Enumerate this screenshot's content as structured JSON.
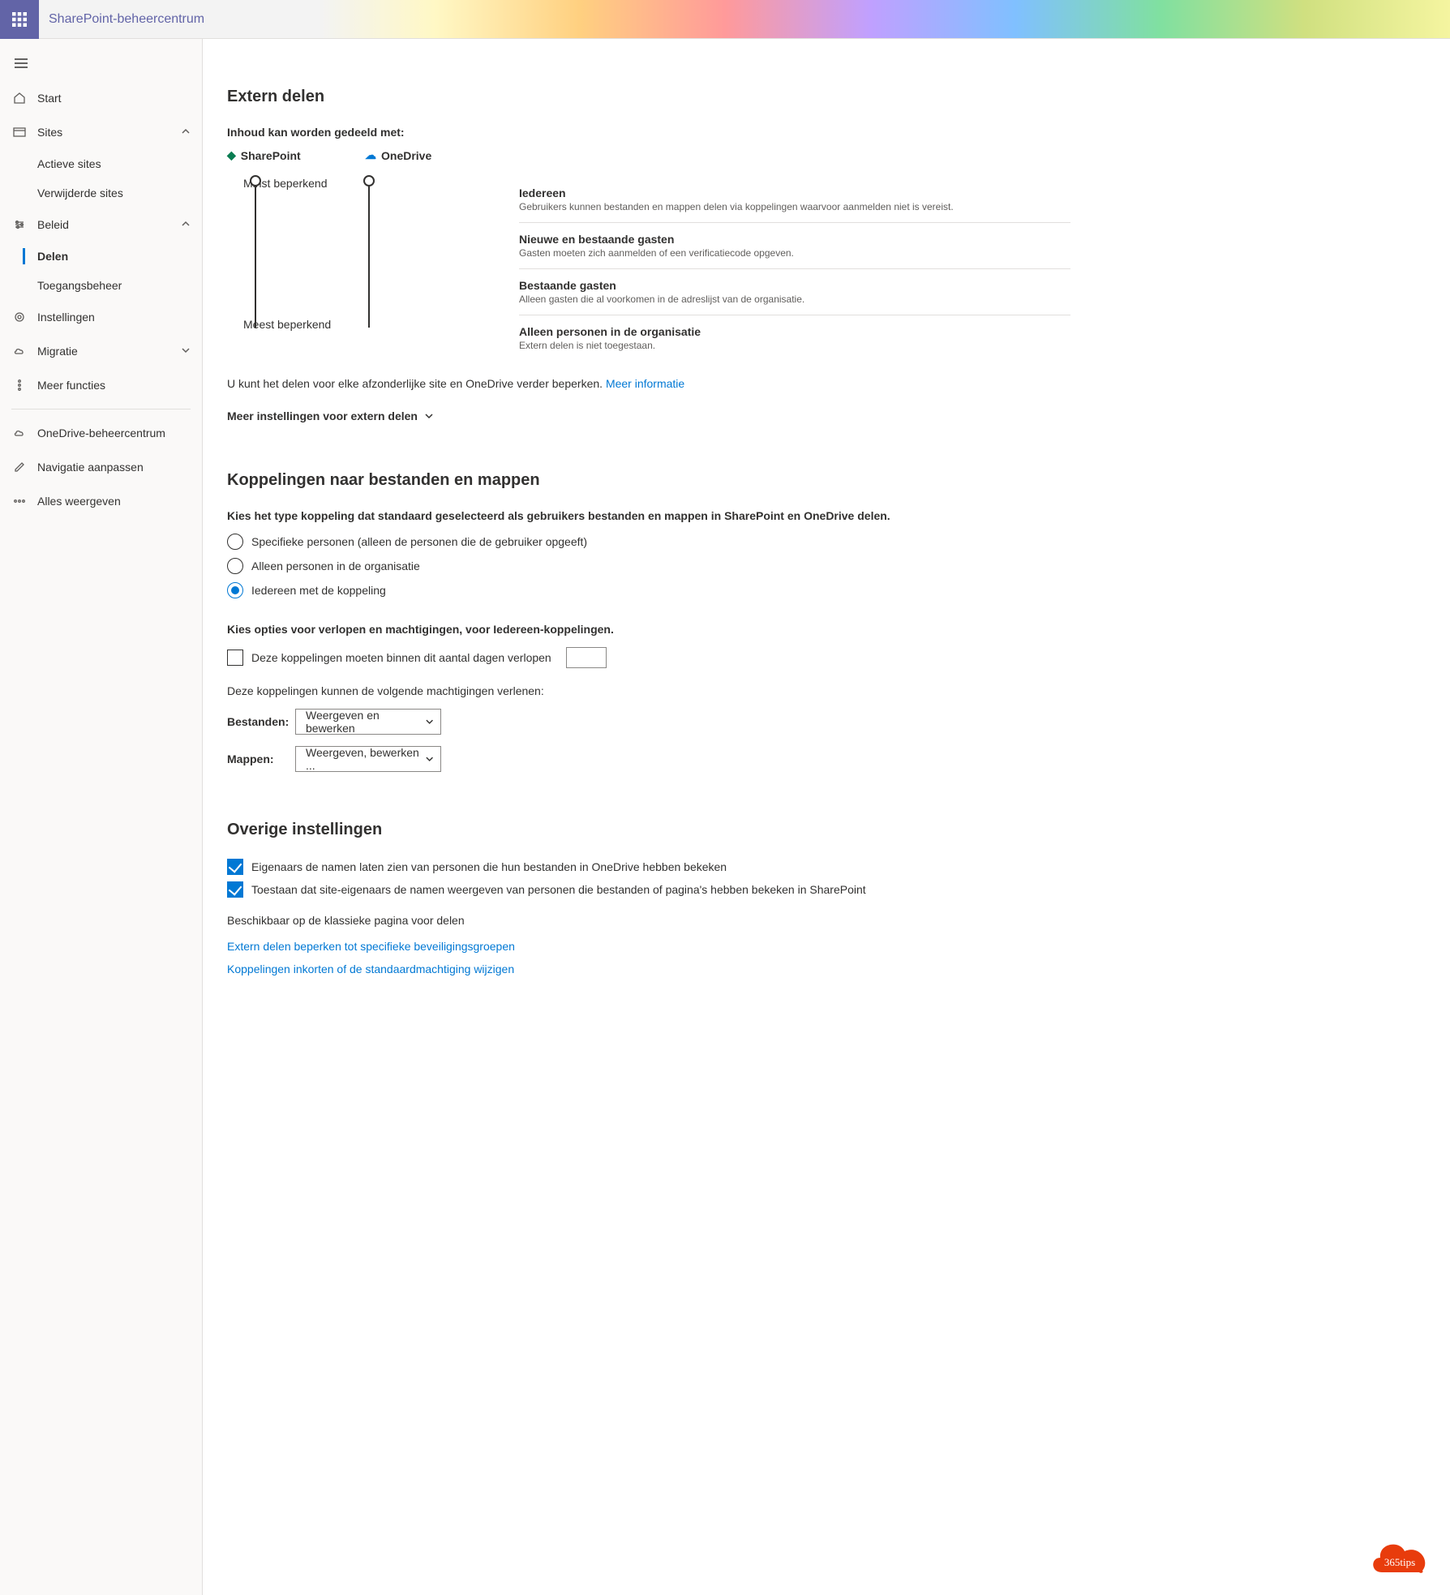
{
  "header": {
    "app_title": "SharePoint-beheercentrum"
  },
  "sidebar": {
    "items": [
      {
        "label": "Start",
        "icon": "home"
      },
      {
        "label": "Sites",
        "icon": "sites",
        "expanded": true,
        "children": [
          {
            "label": "Actieve sites"
          },
          {
            "label": "Verwijderde sites"
          }
        ]
      },
      {
        "label": "Beleid",
        "icon": "policy",
        "expanded": true,
        "children": [
          {
            "label": "Delen",
            "active": true
          },
          {
            "label": "Toegangsbeheer"
          }
        ]
      },
      {
        "label": "Instellingen",
        "icon": "gear"
      },
      {
        "label": "Migratie",
        "icon": "cloud",
        "expandable": true
      },
      {
        "label": "Meer functies",
        "icon": "dots"
      }
    ],
    "secondary": [
      {
        "label": "OneDrive-beheercentrum",
        "icon": "onedrive"
      },
      {
        "label": "Navigatie aanpassen",
        "icon": "edit"
      },
      {
        "label": "Alles weergeven",
        "icon": "more"
      }
    ]
  },
  "extern": {
    "heading": "Extern delen",
    "lead": "Inhoud kan worden gedeeld met:",
    "sp": "SharePoint",
    "od": "OneDrive",
    "min": "Minst beperkend",
    "max": "Meest beperkend",
    "levels": [
      {
        "t": "Iedereen",
        "s": "Gebruikers kunnen bestanden en mappen delen via koppelingen waarvoor aanmelden niet is vereist."
      },
      {
        "t": "Nieuwe en bestaande gasten",
        "s": "Gasten moeten zich aanmelden of een verificatiecode opgeven."
      },
      {
        "t": "Bestaande gasten",
        "s": "Alleen gasten die al voorkomen in de adreslijst van de organisatie."
      },
      {
        "t": "Alleen personen in de organisatie",
        "s": "Extern delen is niet toegestaan."
      }
    ],
    "helper_pre": "U kunt het delen voor elke afzonderlijke site en OneDrive verder beperken.",
    "helper_link": "Meer informatie",
    "more": "Meer instellingen voor extern delen"
  },
  "koppel": {
    "heading": "Koppelingen naar bestanden en mappen",
    "lead": "Kies het type koppeling dat standaard geselecteerd als gebruikers bestanden en mappen in SharePoint en OneDrive delen.",
    "radios": [
      "Specifieke personen (alleen de personen die de gebruiker opgeeft)",
      "Alleen personen in de organisatie",
      "Iedereen met de koppeling"
    ],
    "selected_radio": 2,
    "expire_lead": "Kies opties voor verlopen en machtigingen, voor Iedereen-koppelingen.",
    "expire_label": "Deze koppelingen moeten binnen dit aantal dagen verlopen",
    "perm_text": "Deze koppelingen kunnen de volgende machtigingen verlenen:",
    "files_label": "Bestanden:",
    "files_value": "Weergeven en bewerken",
    "folders_label": "Mappen:",
    "folders_value": "Weergeven, bewerken ..."
  },
  "overige": {
    "heading": "Overige instellingen",
    "checks": [
      "Eigenaars de namen laten zien van personen die hun bestanden in OneDrive hebben bekeken",
      "Toestaan dat site-eigenaars de namen weergeven van personen die bestanden of pagina's hebben bekeken in SharePoint"
    ],
    "classic": "Beschikbaar op de klassieke pagina voor delen",
    "links": [
      "Extern delen beperken tot specifieke beveiligingsgroepen",
      "Koppelingen inkorten of de standaardmachtiging wijzigen"
    ]
  },
  "badge": "365tips"
}
